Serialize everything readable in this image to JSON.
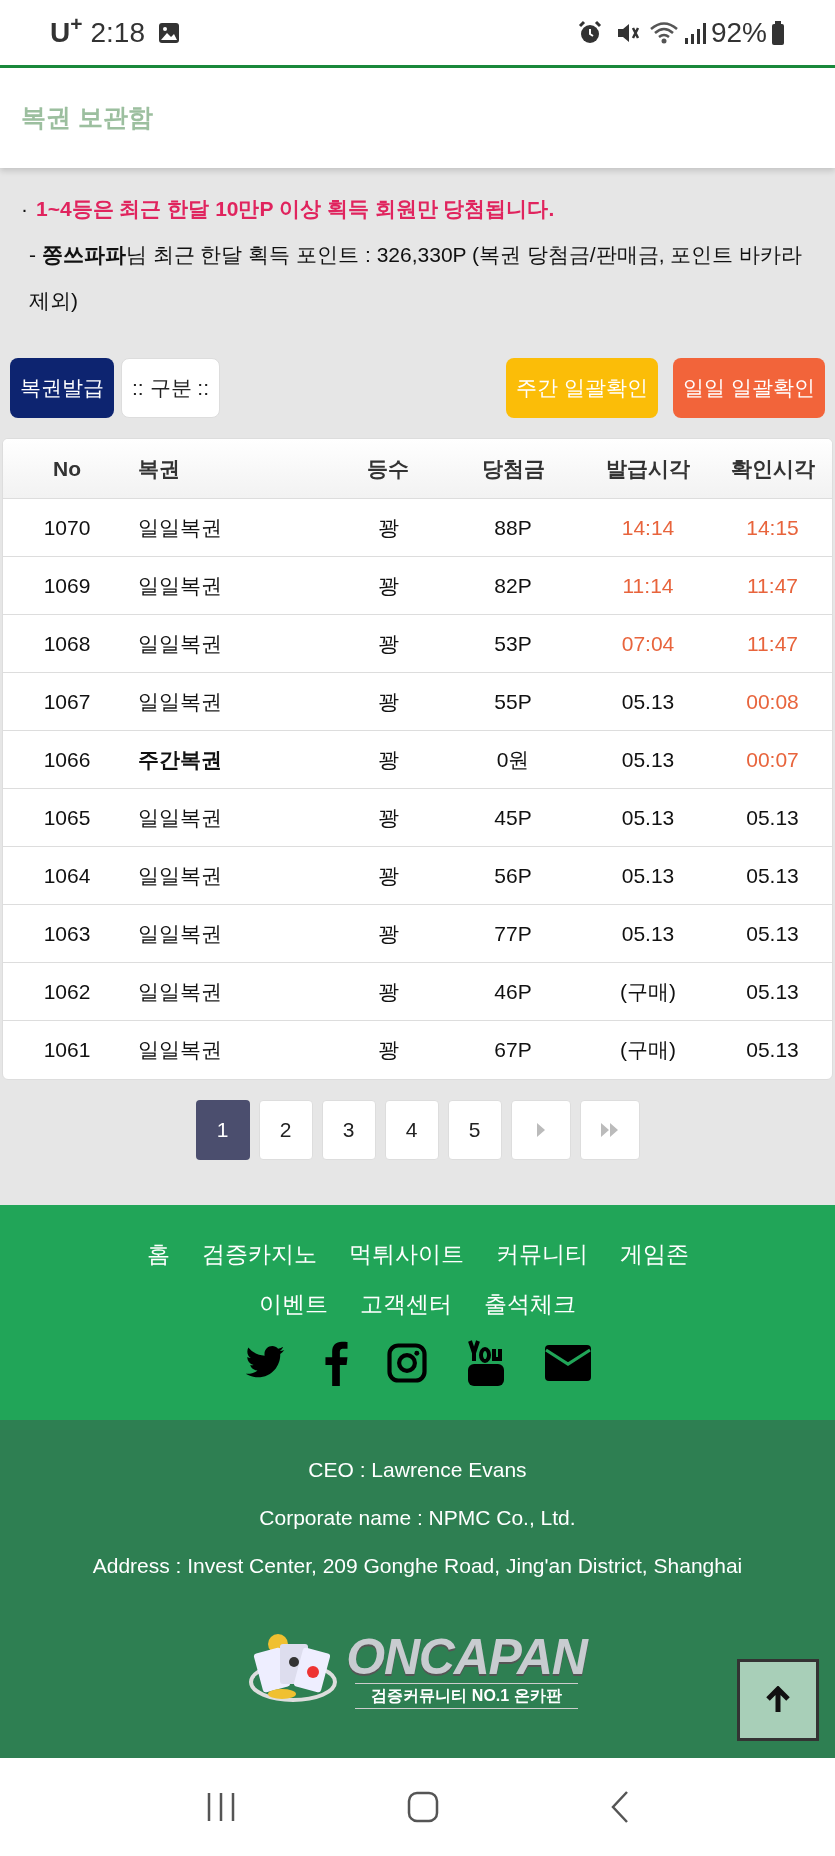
{
  "status_bar": {
    "carrier": "U$^{+}$",
    "time": "2:18",
    "battery": "92%"
  },
  "header": {
    "title": "복권 보관함"
  },
  "notice": {
    "bullet": "·",
    "warning": "1~4등은 최근 한달 10만P 이상 획득 회원만 당첨됩니다.",
    "points": "- **쫑쓰파파**님 최근 한달 획득 포인트 : 326,330P (복권 당첨금/판매금, 포인트 바카라 제외)"
  },
  "left_buttons": [
    {
      "label": "복권발급",
      "kind": "primary"
    },
    {
      "label": ":: 구분 ::",
      "kind": "select"
    }
  ],
  "right_buttons": [
    {
      "label": "주간 일괄확인",
      "kind": "weekly"
    },
    {
      "label": "일일 일괄확인",
      "kind": "daily"
    }
  ],
  "table": {
    "columns": [
      "No",
      "복권",
      "등수",
      "당첨금",
      "발급시각",
      "확인시각"
    ],
    "rows": [
      {
        "no": "1070",
        "ticket": "일일복권",
        "kind": "daily",
        "rank": "꽝",
        "prize": "88P",
        "issued": "14:14",
        "issued_recent": true,
        "checked": "14:15",
        "checked_recent": true
      },
      {
        "no": "1069",
        "ticket": "일일복권",
        "kind": "daily",
        "rank": "꽝",
        "prize": "82P",
        "issued": "11:14",
        "issued_recent": true,
        "checked": "11:47",
        "checked_recent": true
      },
      {
        "no": "1068",
        "ticket": "일일복권",
        "kind": "daily",
        "rank": "꽝",
        "prize": "53P",
        "issued": "07:04",
        "issued_recent": true,
        "checked": "11:47",
        "checked_recent": true
      },
      {
        "no": "1067",
        "ticket": "일일복권",
        "kind": "daily",
        "rank": "꽝",
        "prize": "55P",
        "issued": "05.13",
        "issued_recent": false,
        "checked": "00:08",
        "checked_recent": true
      },
      {
        "no": "1066",
        "ticket": "주간복권",
        "kind": "weekly",
        "rank": "꽝",
        "prize": "0원",
        "issued": "05.13",
        "issued_recent": false,
        "checked": "00:07",
        "checked_recent": true
      },
      {
        "no": "1065",
        "ticket": "일일복권",
        "kind": "daily",
        "rank": "꽝",
        "prize": "45P",
        "issued": "05.13",
        "issued_recent": false,
        "checked": "05.13",
        "checked_recent": false
      },
      {
        "no": "1064",
        "ticket": "일일복권",
        "kind": "daily",
        "rank": "꽝",
        "prize": "56P",
        "issued": "05.13",
        "issued_recent": false,
        "checked": "05.13",
        "checked_recent": false
      },
      {
        "no": "1063",
        "ticket": "일일복권",
        "kind": "daily",
        "rank": "꽝",
        "prize": "77P",
        "issued": "05.13",
        "issued_recent": false,
        "checked": "05.13",
        "checked_recent": false
      },
      {
        "no": "1062",
        "ticket": "일일복권",
        "kind": "daily",
        "rank": "꽝",
        "prize": "46P",
        "issued": "(구매)",
        "issued_recent": false,
        "checked": "05.13",
        "checked_recent": false
      },
      {
        "no": "1061",
        "ticket": "일일복권",
        "kind": "daily",
        "rank": "꽝",
        "prize": "67P",
        "issued": "(구매)",
        "issued_recent": false,
        "checked": "05.13",
        "checked_recent": false
      }
    ]
  },
  "pagination": {
    "pages": [
      {
        "label": "1",
        "selected": true
      },
      {
        "label": "2",
        "selected": false
      },
      {
        "label": "3",
        "selected": false
      },
      {
        "label": "4",
        "selected": false
      },
      {
        "label": "5",
        "selected": false
      }
    ]
  },
  "footer": {
    "links": [
      "홈",
      "검증카지노",
      "먹튀사이트",
      "커뮤니티",
      "게임존",
      "이벤트",
      "고객센터",
      "출석체크"
    ],
    "company": [
      "CEO : Lawrence Evans",
      "Corporate name : NPMC Co., Ltd.",
      "Address : Invest Center, 209 Gonghe Road, Jing'an District, Shanghai"
    ],
    "logo": {
      "name": "ONCAPAN",
      "tagline": "검증커뮤니티 NO.1 온카판"
    }
  }
}
